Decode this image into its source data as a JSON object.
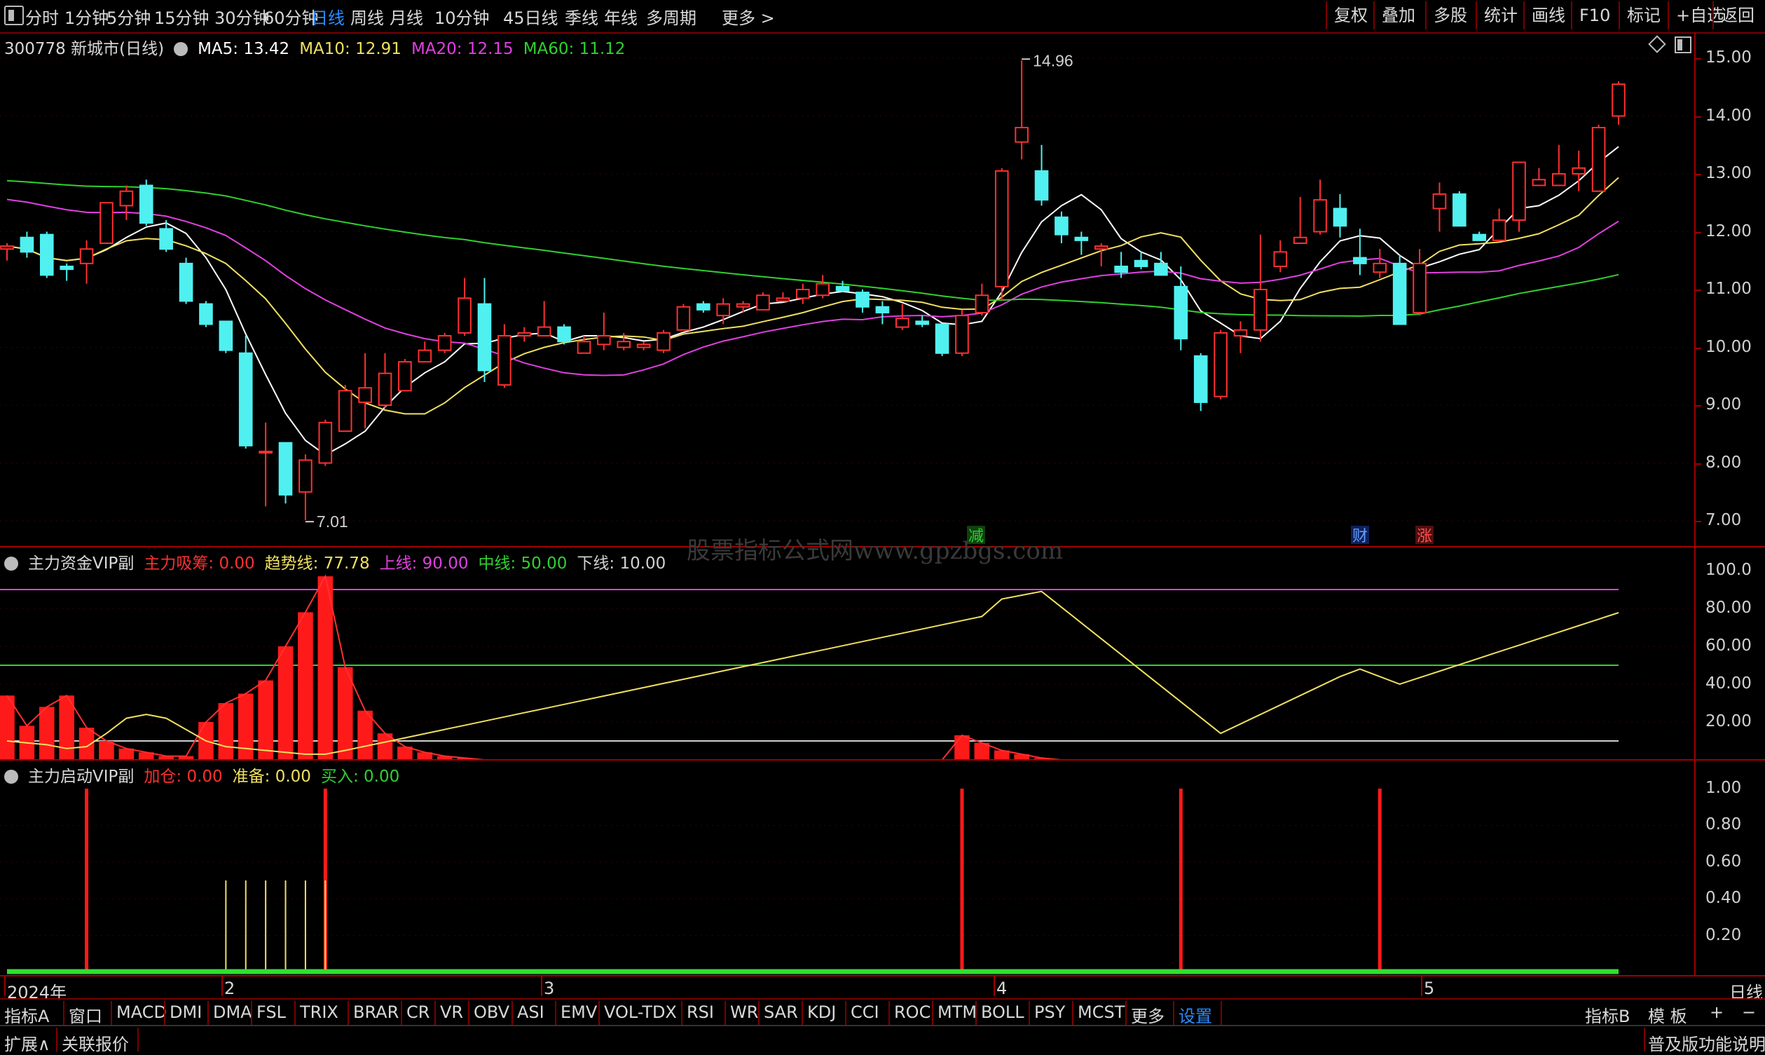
{
  "toolbar": {
    "periods": [
      "分时",
      "1分钟",
      "5分钟",
      "15分钟",
      "30分钟",
      "60分钟",
      "日线",
      "周线",
      "月线",
      "10分钟",
      "45日线",
      "季线",
      "年线",
      "多周期",
      "更多 >"
    ],
    "active_period": "日线",
    "right_buttons": [
      "复权",
      "叠加",
      "多股",
      "统计",
      "画线",
      "F10",
      "标记",
      "+自选",
      "返回"
    ]
  },
  "stock": {
    "code_name": "300778 新城市(日线)",
    "ma": [
      {
        "label": "MA5: 13.42",
        "color": "#ffffff"
      },
      {
        "label": "MA10: 12.91",
        "color": "#f0e060"
      },
      {
        "label": "MA20: 12.15",
        "color": "#e040e0"
      },
      {
        "label": "MA60: 11.12",
        "color": "#30d030"
      }
    ],
    "high_label": "14.96",
    "low_label": "7.01",
    "markers": [
      {
        "text": "减",
        "color": "#30d030",
        "bg": "#104010"
      },
      {
        "text": "财",
        "color": "#60a0ff",
        "bg": "#10205a"
      },
      {
        "text": "涨",
        "color": "#ff5050",
        "bg": "#501010"
      }
    ]
  },
  "price_axis": [
    "15.00",
    "14.00",
    "13.00",
    "12.00",
    "11.00",
    "10.00",
    "9.00",
    "8.00",
    "7.00"
  ],
  "indicator1": {
    "name": "主力资金VIP副",
    "fields": [
      {
        "label": "主力吸筹: 0.00",
        "color": "#ff3030"
      },
      {
        "label": "趋势线: 77.78",
        "color": "#f0e060"
      },
      {
        "label": "上线: 90.00",
        "color": "#e040e0"
      },
      {
        "label": "中线: 50.00",
        "color": "#30d030"
      },
      {
        "label": "下线: 10.00",
        "color": "#d0d0d0"
      }
    ],
    "axis": [
      "100.0",
      "80.00",
      "60.00",
      "40.00",
      "20.00"
    ]
  },
  "indicator2": {
    "name": "主力启动VIP副",
    "fields": [
      {
        "label": "加仓: 0.00",
        "color": "#ff3030"
      },
      {
        "label": "准备: 0.00",
        "color": "#f0e060"
      },
      {
        "label": "买入: 0.00",
        "color": "#30d030"
      }
    ],
    "axis": [
      "1.00",
      "0.80",
      "0.60",
      "0.40",
      "0.20"
    ]
  },
  "date_axis": {
    "labels": [
      "2024年",
      "2",
      "3",
      "4",
      "5"
    ],
    "period_label": "日线"
  },
  "watermark": "股票指标公式网www.gpzbgs.com",
  "tabs": [
    "指标A",
    "窗口",
    "MACD",
    "DMI",
    "DMA",
    "FSL",
    "TRIX",
    "BRAR",
    "CR",
    "VR",
    "OBV",
    "ASI",
    "EMV",
    "VOL-TDX",
    "RSI",
    "WR",
    "SAR",
    "KDJ",
    "CCI",
    "ROC",
    "MTM",
    "BOLL",
    "PSY",
    "MCST",
    "更多",
    "设置"
  ],
  "tabs_right": [
    "指标B",
    "模 板",
    "+",
    "−"
  ],
  "status": {
    "left1": "扩展∧",
    "left2": "关联报价",
    "right": "普及版功能说明"
  },
  "chart_data": {
    "type": "candlestick",
    "series_ohlc": [
      [
        11.7,
        11.8,
        11.5,
        11.75
      ],
      [
        11.9,
        12.0,
        11.55,
        11.65
      ],
      [
        11.95,
        12.0,
        11.2,
        11.25
      ],
      [
        11.4,
        11.45,
        11.15,
        11.35
      ],
      [
        11.45,
        11.85,
        11.1,
        11.7
      ],
      [
        11.8,
        12.5,
        11.8,
        12.5
      ],
      [
        12.45,
        12.8,
        12.2,
        12.7
      ],
      [
        12.8,
        12.9,
        12.1,
        12.15
      ],
      [
        12.05,
        12.2,
        11.65,
        11.7
      ],
      [
        11.45,
        11.55,
        10.75,
        10.8
      ],
      [
        10.75,
        10.8,
        10.35,
        10.4
      ],
      [
        10.45,
        10.45,
        9.9,
        9.95
      ],
      [
        9.9,
        10.2,
        8.25,
        8.3
      ],
      [
        8.2,
        8.7,
        7.25,
        8.2
      ],
      [
        8.35,
        8.35,
        7.3,
        7.45
      ],
      [
        7.5,
        8.15,
        7.01,
        8.05
      ],
      [
        8.0,
        8.75,
        7.95,
        8.7
      ],
      [
        8.55,
        9.35,
        8.55,
        9.25
      ],
      [
        9.05,
        9.9,
        8.6,
        9.3
      ],
      [
        9.0,
        9.9,
        8.95,
        9.55
      ],
      [
        9.25,
        9.8,
        9.25,
        9.75
      ],
      [
        9.75,
        10.1,
        9.75,
        9.95
      ],
      [
        9.95,
        10.25,
        9.9,
        10.2
      ],
      [
        10.25,
        11.2,
        10.2,
        10.85
      ],
      [
        10.75,
        11.2,
        9.4,
        9.6
      ],
      [
        9.35,
        10.4,
        9.3,
        10.2
      ],
      [
        10.2,
        10.35,
        10.1,
        10.25
      ],
      [
        10.2,
        10.8,
        10.2,
        10.35
      ],
      [
        10.35,
        10.4,
        10.05,
        10.1
      ],
      [
        9.9,
        10.2,
        9.9,
        10.1
      ],
      [
        10.05,
        10.6,
        9.95,
        10.2
      ],
      [
        10.0,
        10.25,
        9.95,
        10.1
      ],
      [
        10.0,
        10.1,
        9.95,
        10.05
      ],
      [
        9.95,
        10.3,
        9.9,
        10.25
      ],
      [
        10.3,
        10.75,
        10.3,
        10.7
      ],
      [
        10.75,
        10.8,
        10.6,
        10.65
      ],
      [
        10.55,
        10.85,
        10.4,
        10.75
      ],
      [
        10.7,
        10.8,
        10.6,
        10.75
      ],
      [
        10.65,
        10.95,
        10.65,
        10.9
      ],
      [
        10.8,
        10.95,
        10.8,
        10.85
      ],
      [
        10.85,
        11.1,
        10.75,
        11.0
      ],
      [
        10.9,
        11.25,
        10.85,
        11.1
      ],
      [
        11.05,
        11.15,
        10.95,
        10.98
      ],
      [
        10.95,
        11.0,
        10.6,
        10.7
      ],
      [
        10.7,
        10.8,
        10.4,
        10.6
      ],
      [
        10.35,
        10.75,
        10.3,
        10.5
      ],
      [
        10.45,
        10.55,
        10.35,
        10.4
      ],
      [
        10.4,
        10.4,
        9.85,
        9.9
      ],
      [
        9.9,
        10.65,
        9.85,
        10.55
      ],
      [
        10.6,
        11.1,
        10.55,
        10.9
      ],
      [
        11.05,
        13.1,
        10.8,
        13.05
      ],
      [
        13.55,
        14.96,
        13.25,
        13.8
      ],
      [
        13.05,
        13.5,
        12.45,
        12.55
      ],
      [
        12.25,
        12.35,
        11.8,
        11.95
      ],
      [
        11.9,
        12.0,
        11.6,
        11.85
      ],
      [
        11.7,
        11.8,
        11.4,
        11.75
      ],
      [
        11.4,
        11.65,
        11.2,
        11.3
      ],
      [
        11.5,
        11.65,
        11.35,
        11.4
      ],
      [
        11.45,
        11.65,
        11.25,
        11.25
      ],
      [
        11.05,
        11.4,
        9.95,
        10.15
      ],
      [
        9.85,
        9.9,
        8.9,
        9.05
      ],
      [
        9.15,
        10.3,
        9.1,
        10.25
      ],
      [
        10.2,
        10.45,
        9.9,
        10.3
      ],
      [
        10.3,
        11.95,
        10.1,
        11.0
      ],
      [
        11.4,
        11.85,
        11.3,
        11.65
      ],
      [
        11.8,
        12.6,
        11.8,
        11.9
      ],
      [
        12.0,
        12.9,
        11.95,
        12.55
      ],
      [
        12.4,
        12.65,
        11.9,
        12.1
      ],
      [
        11.55,
        12.05,
        11.25,
        11.45
      ],
      [
        11.3,
        11.7,
        11.2,
        11.45
      ],
      [
        11.45,
        11.6,
        10.7,
        10.4
      ],
      [
        10.6,
        11.7,
        10.55,
        11.45
      ],
      [
        12.4,
        12.85,
        12.0,
        12.65
      ],
      [
        12.65,
        12.7,
        12.1,
        12.1
      ],
      [
        11.95,
        12.0,
        11.85,
        11.85
      ],
      [
        11.85,
        12.4,
        11.85,
        12.2
      ],
      [
        12.2,
        13.2,
        12.0,
        13.2
      ],
      [
        12.8,
        13.1,
        12.8,
        12.9
      ],
      [
        12.8,
        13.5,
        12.8,
        13.0
      ],
      [
        13.0,
        13.4,
        12.7,
        13.1
      ],
      [
        12.7,
        13.85,
        12.7,
        13.8
      ],
      [
        14.0,
        14.6,
        13.85,
        14.55
      ]
    ],
    "xlabels": [
      "2024年",
      "2",
      "3",
      "4",
      "5"
    ],
    "ylim": [
      6.8,
      15.2
    ],
    "ma5_label": "MA5: 13.42",
    "ma10_label": "MA10: 12.91",
    "ma20_label": "MA20: 12.15",
    "ma60_label": "MA60: 11.12"
  }
}
